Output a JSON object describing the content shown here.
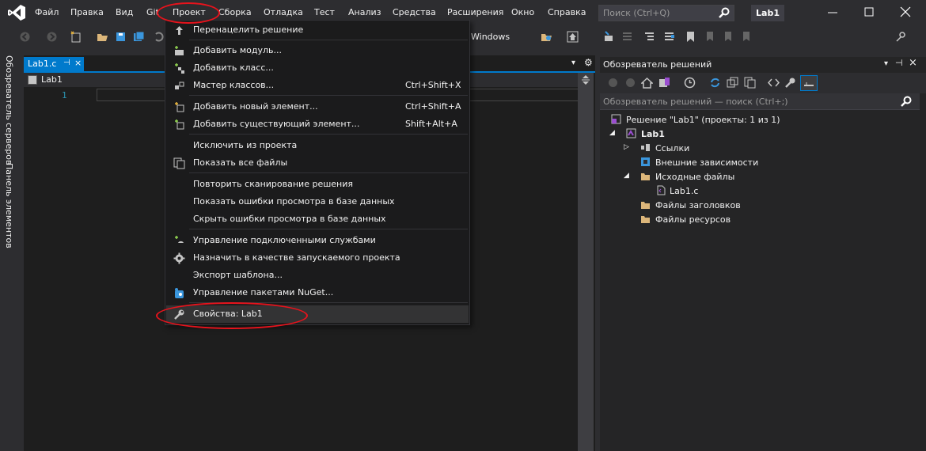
{
  "menubar": {
    "items": [
      "Файл",
      "Правка",
      "Вид",
      "Git",
      "Проект",
      "Сборка",
      "Отладка",
      "Тест",
      "Анализ",
      "Средства",
      "Расширения",
      "Окно",
      "Справка"
    ],
    "search_placeholder": "Поиск (Ctrl+Q)",
    "solution_name": "Lab1"
  },
  "toolbar": {
    "platform": "Windows"
  },
  "left_strip": {
    "tab1": "Обозреватель серверов",
    "tab2": "Панель элементов"
  },
  "editor": {
    "tab_label": "Lab1.c",
    "tab_pin": "⊣",
    "tab_close": "×",
    "nav_file": "Lab1",
    "line_number": "1"
  },
  "project_menu": {
    "items": [
      {
        "label": "Перенацелить решение",
        "shortcut": "",
        "icon": "retarget-icon"
      },
      {
        "label": "Добавить модуль...",
        "shortcut": "",
        "icon": "add-module-icon"
      },
      {
        "label": "Добавить класс...",
        "shortcut": "",
        "icon": "add-class-icon"
      },
      {
        "label": "Мастер классов...",
        "shortcut": "Ctrl+Shift+X",
        "icon": "class-wizard-icon"
      },
      {
        "label": "Добавить новый элемент...",
        "shortcut": "Ctrl+Shift+A",
        "icon": "add-new-item-icon"
      },
      {
        "label": "Добавить существующий элемент...",
        "shortcut": "Shift+Alt+A",
        "icon": "add-existing-item-icon"
      },
      {
        "label": "Исключить из проекта",
        "shortcut": "",
        "icon": ""
      },
      {
        "label": "Показать все файлы",
        "shortcut": "",
        "icon": "show-all-files-icon"
      },
      {
        "label": "Повторить сканирование решения",
        "shortcut": "",
        "icon": ""
      },
      {
        "label": "Показать ошибки просмотра в базе данных",
        "shortcut": "",
        "icon": ""
      },
      {
        "label": "Скрыть ошибки просмотра в базе данных",
        "shortcut": "",
        "icon": ""
      },
      {
        "label": "Управление подключенными службами",
        "shortcut": "",
        "icon": "connected-services-icon"
      },
      {
        "label": "Назначить в качестве запускаемого проекта",
        "shortcut": "",
        "icon": "gear-icon"
      },
      {
        "label": "Экспорт шаблона...",
        "shortcut": "",
        "icon": ""
      },
      {
        "label": "Управление пакетами NuGet...",
        "shortcut": "",
        "icon": "nuget-icon"
      },
      {
        "label": "Свойства: Lab1",
        "shortcut": "",
        "icon": "wrench-icon"
      }
    ]
  },
  "solution_explorer": {
    "title": "Обозреватель решений",
    "search_placeholder": "Обозреватель решений — поиск (Ctrl+;)",
    "solution": "Решение \"Lab1\" (проекты: 1 из 1)",
    "project": "Lab1",
    "nodes": [
      "Ссылки",
      "Внешние зависимости",
      "Исходные файлы",
      "Lab1.c",
      "Файлы заголовков",
      "Файлы ресурсов"
    ]
  },
  "colors": {
    "accent": "#007acc",
    "annotation": "#e8131c",
    "background": "#2d2d30"
  }
}
